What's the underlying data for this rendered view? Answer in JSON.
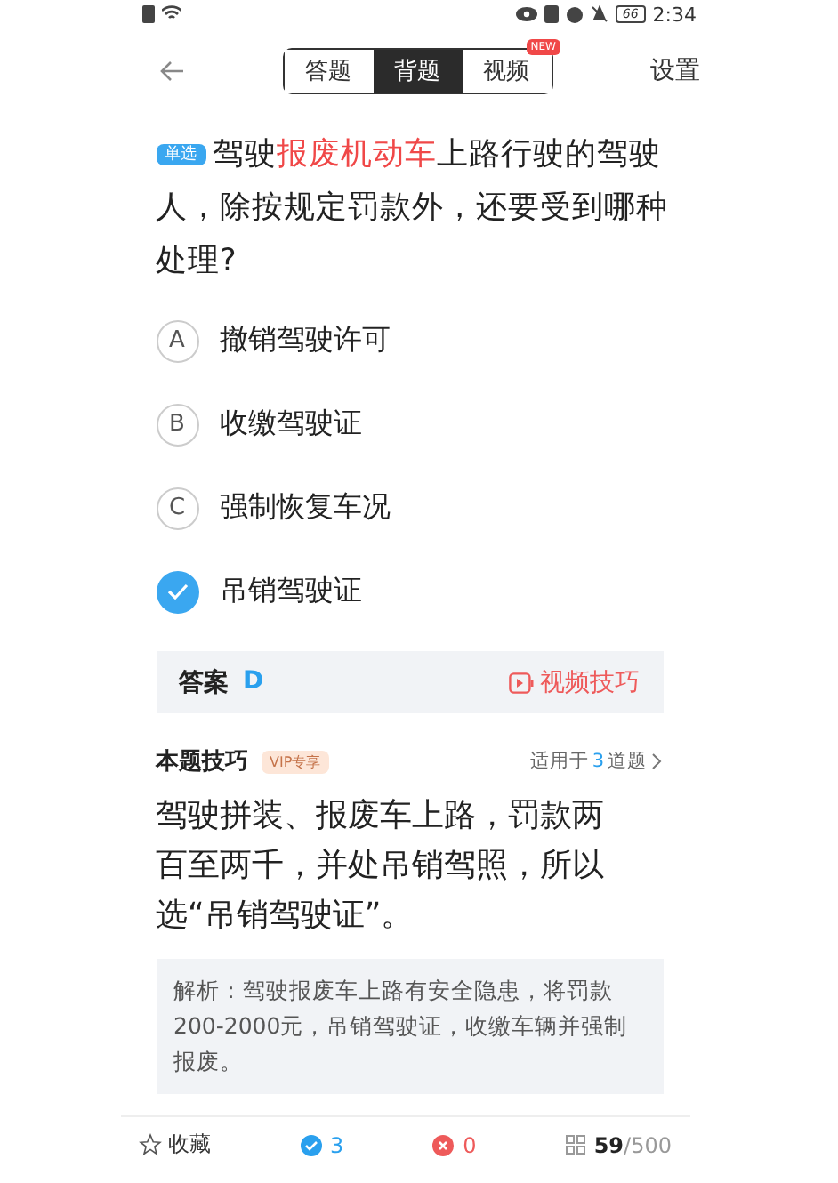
{
  "status_bar": {
    "battery": "66",
    "time": "2:34"
  },
  "nav": {
    "tabs": [
      {
        "label": "答题",
        "selected": false
      },
      {
        "label": "背题",
        "selected": true
      },
      {
        "label": "视频",
        "selected": false,
        "badge": "NEW"
      }
    ],
    "settings": "设置"
  },
  "question": {
    "type_tag": "单选",
    "segments": [
      {
        "text": "驾驶",
        "highlight": false
      },
      {
        "text": "报废机动车",
        "highlight": true
      },
      {
        "text": "上路行驶的驾驶人，除按规定罚款外，还要受到哪种处理?",
        "highlight": false
      }
    ]
  },
  "options": [
    {
      "letter": "A",
      "text": "撤销驾驶许可",
      "selected": false
    },
    {
      "letter": "B",
      "text": "收缴驾驶证",
      "selected": false
    },
    {
      "letter": "C",
      "text": "强制恢复车况",
      "selected": false
    },
    {
      "text": "吊销驾驶证",
      "selected": true
    }
  ],
  "answer": {
    "label": "答案",
    "value": "D",
    "video_link": "视频技巧"
  },
  "tip": {
    "title": "本题技巧",
    "badge": "VIP专享",
    "applies": [
      {
        "text": "适用于",
        "highlight": false
      },
      {
        "text": "3",
        "highlight": true
      },
      {
        "text": "道题",
        "highlight": false
      }
    ],
    "body": "驾驶拼装、报废车上路，罚款两百至两千，并处吊销驾照，所以选“吊销驾驶证”。"
  },
  "analysis": "解析：驾驶报废车上路有安全隐患，将罚款200-2000元，吊销驾驶证，收缴车辆并强制报废。",
  "bottom_bar": {
    "favorite": "收藏",
    "correct": "3",
    "wrong": "0",
    "progress": "**59**/500"
  }
}
